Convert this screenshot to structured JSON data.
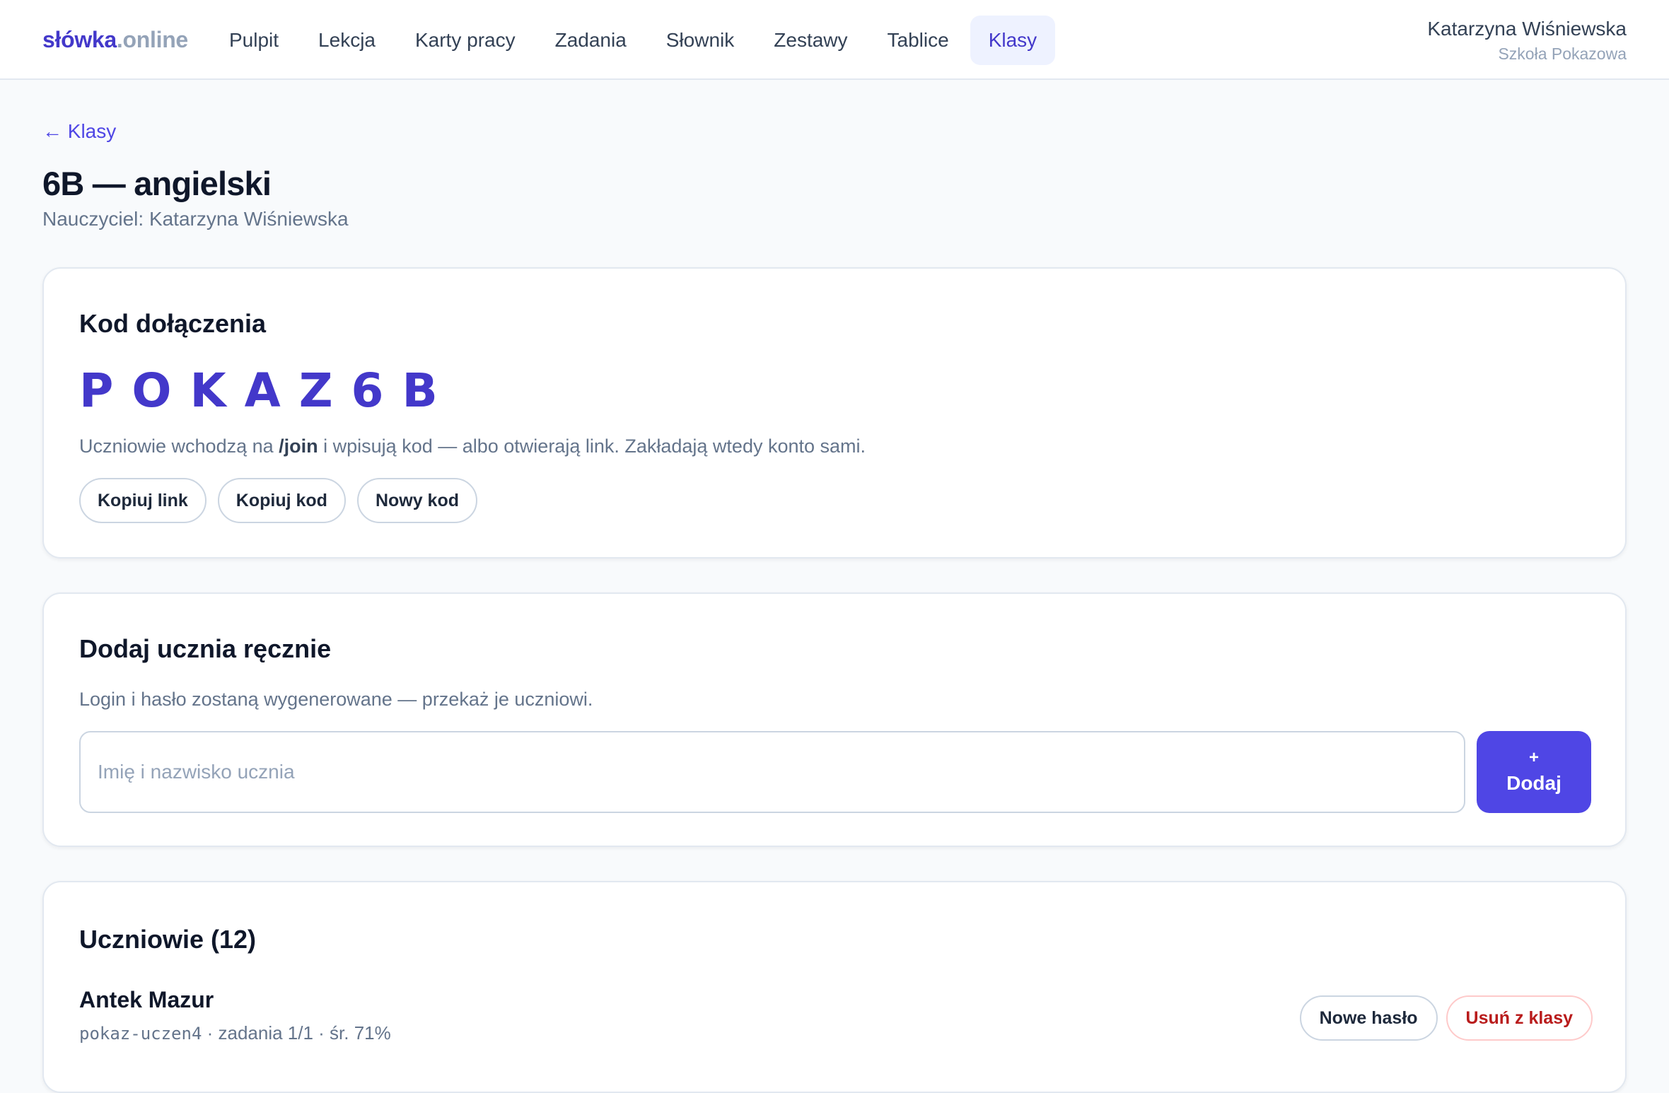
{
  "brand": {
    "part1": "słówka",
    "part2": ".online"
  },
  "nav": {
    "items": [
      {
        "label": "Pulpit"
      },
      {
        "label": "Lekcja"
      },
      {
        "label": "Karty pracy"
      },
      {
        "label": "Zadania"
      },
      {
        "label": "Słownik"
      },
      {
        "label": "Zestawy"
      },
      {
        "label": "Tablice"
      },
      {
        "label": "Klasy",
        "active": true
      }
    ]
  },
  "user": {
    "name": "Katarzyna Wiśniewska",
    "school": "Szkoła Pokazowa"
  },
  "page": {
    "back_label": "← Klasy",
    "title": "6B — angielski",
    "subtitle": "Nauczyciel: Katarzyna Wiśniewska"
  },
  "join": {
    "title": "Kod dołączenia",
    "code": "POKAZ6B",
    "desc_before": "Uczniowie wchodzą na ",
    "desc_path": "/join",
    "desc_after": " i wpisują kod — albo otwierają link. Zakładają wtedy konto sami.",
    "copy_link_label": "Kopiuj link",
    "copy_code_label": "Kopiuj kod",
    "new_code_label": "Nowy kod"
  },
  "add_student": {
    "title": "Dodaj ucznia ręcznie",
    "desc": "Login i hasło zostaną wygenerowane — przekaż je uczniowi.",
    "input_placeholder": "Imię i nazwisko ucznia",
    "input_value": "",
    "add_plus": "+",
    "add_label": "Dodaj"
  },
  "students": {
    "title": "Uczniowie (12)",
    "items": [
      {
        "name": "Antek Mazur",
        "login": "pokaz-uczen4",
        "stats": " · zadania 1/1 · śr. 71%",
        "reset_label": "Nowe hasło",
        "remove_label": "Usuń z klasy"
      }
    ]
  },
  "colors": {
    "accent": "#4f46e5",
    "accent_text": "#4338ca",
    "accent_bg": "#eef2ff",
    "danger": "#b91c1c",
    "muted": "#64748b",
    "background": "#f8fafc"
  }
}
